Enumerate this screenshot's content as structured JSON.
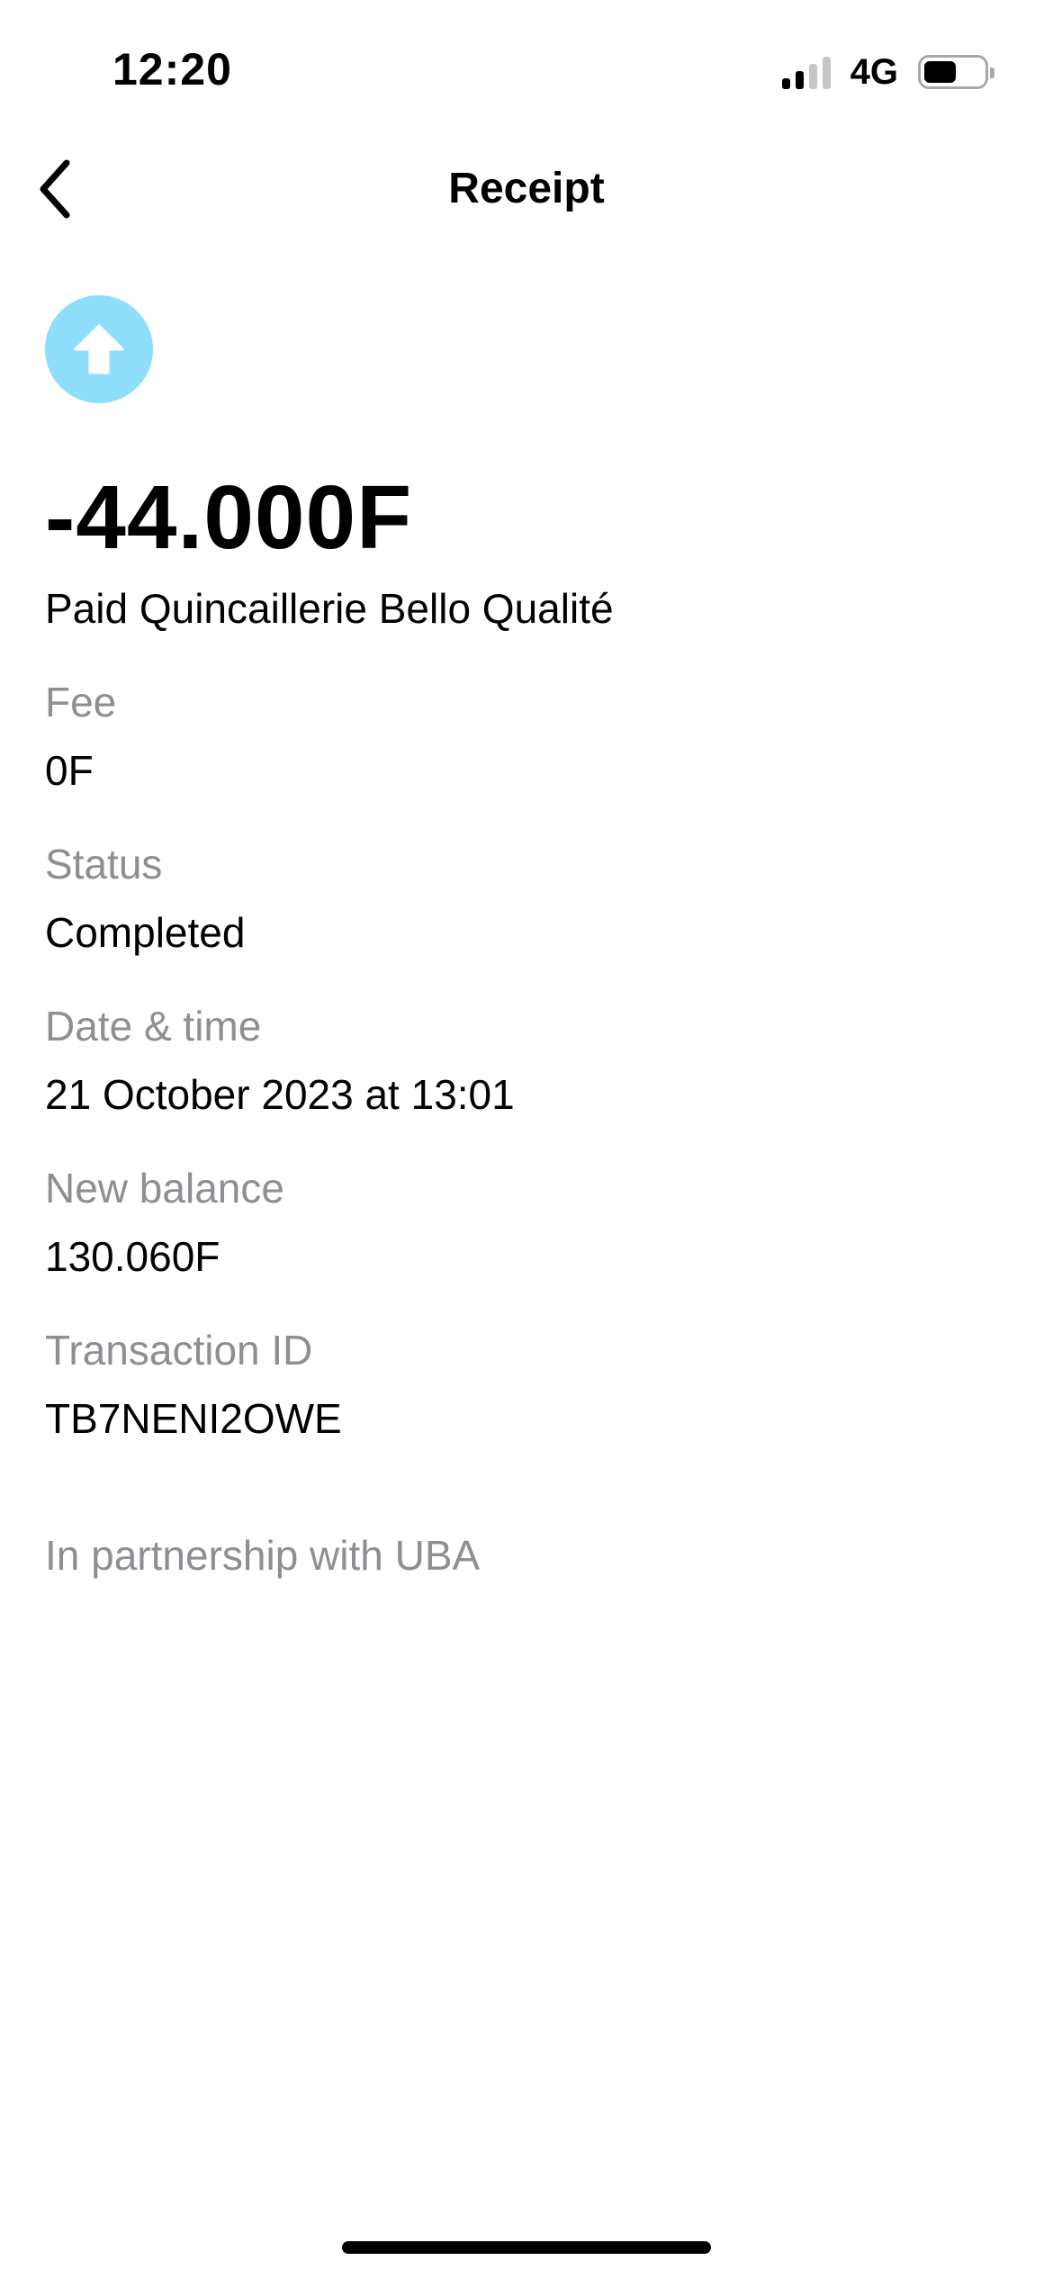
{
  "status_bar": {
    "time": "12:20",
    "network": "4G",
    "signal_bars_active": 2,
    "signal_bars_total": 4,
    "battery_level": 0.55
  },
  "nav": {
    "title": "Receipt",
    "back_icon": "chevron-left-icon"
  },
  "transaction": {
    "icon": "arrow-up-icon",
    "icon_color": "#8fdefb",
    "amount": "-44.000F",
    "description": "Paid Quincaillerie Bello Qualité"
  },
  "details": [
    {
      "label": "Fee",
      "value": "0F"
    },
    {
      "label": "Status",
      "value": "Completed"
    },
    {
      "label": "Date & time",
      "value": "21 October 2023 at 13:01"
    },
    {
      "label": "New balance",
      "value": "130.060F"
    },
    {
      "label": "Transaction ID",
      "value": "TB7NENI2OWE"
    }
  ],
  "footer": {
    "partnership": "In partnership with UBA"
  }
}
